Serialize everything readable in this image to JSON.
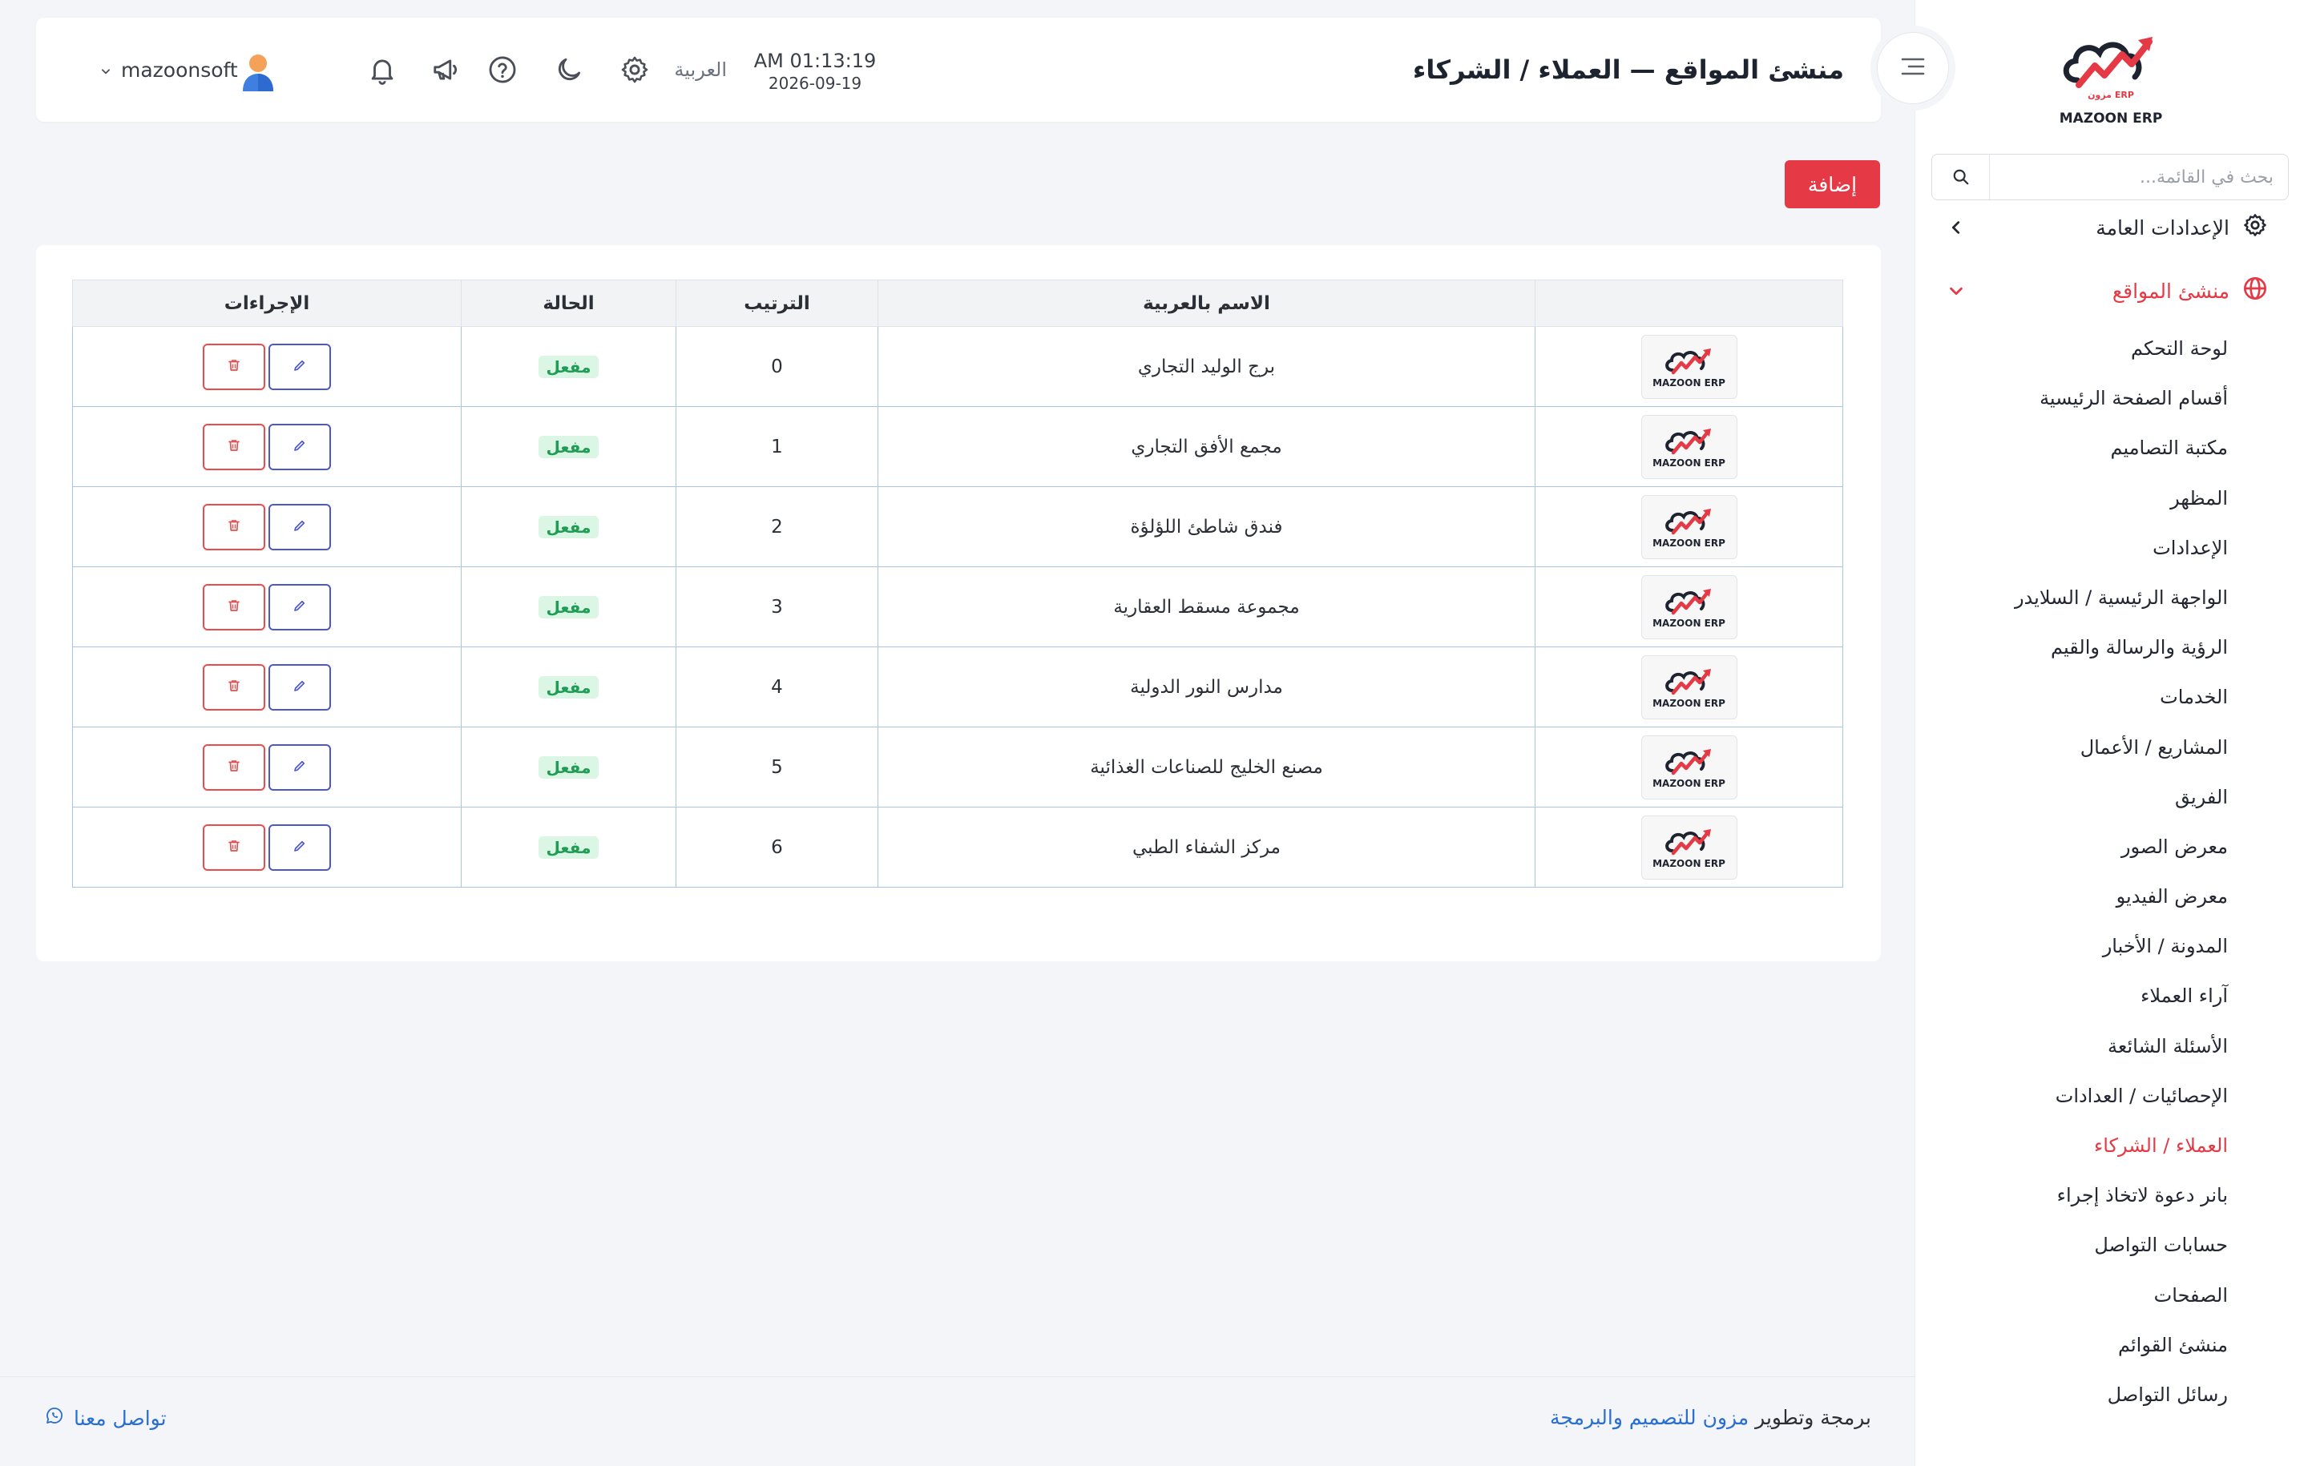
{
  "brand": {
    "name": "MAZOON ERP",
    "small": "مزون ERP"
  },
  "sidebar": {
    "search_placeholder": "بحث في القائمة...",
    "groups": [
      {
        "label": "الإعدادات العامة",
        "icon": "gear-icon",
        "state": "collapsed"
      },
      {
        "label": "منشئ المواقع",
        "icon": "globe-icon",
        "state": "expanded"
      }
    ],
    "items": [
      {
        "label": "لوحة التحكم"
      },
      {
        "label": "أقسام الصفحة الرئيسية"
      },
      {
        "label": "مكتبة التصاميم"
      },
      {
        "label": "المظهر"
      },
      {
        "label": "الإعدادات"
      },
      {
        "label": "الواجهة الرئيسية / السلايدر"
      },
      {
        "label": "الرؤية والرسالة والقيم"
      },
      {
        "label": "الخدمات"
      },
      {
        "label": "المشاريع / الأعمال"
      },
      {
        "label": "الفريق"
      },
      {
        "label": "معرض الصور"
      },
      {
        "label": "معرض الفيديو"
      },
      {
        "label": "المدونة / الأخبار"
      },
      {
        "label": "آراء العملاء"
      },
      {
        "label": "الأسئلة الشائعة"
      },
      {
        "label": "الإحصائيات / العدادات"
      },
      {
        "label": "العملاء / الشركاء",
        "active": true
      },
      {
        "label": "بانر دعوة لاتخاذ إجراء"
      },
      {
        "label": "حسابات التواصل"
      },
      {
        "label": "الصفحات"
      },
      {
        "label": "منشئ القوائم"
      },
      {
        "label": "رسائل التواصل"
      }
    ]
  },
  "header": {
    "title": "منشئ المواقع — العملاء / الشركاء",
    "time": "AM 01:13:19",
    "date": "2026-09-19",
    "language": "العربية",
    "username": "mazoonsoft"
  },
  "toolbar": {
    "add_label": "إضافة"
  },
  "table": {
    "columns": [
      "",
      "الاسم بالعربية",
      "الترتيب",
      "الحالة",
      "الإجراءات"
    ],
    "rows": [
      {
        "name": "برج الوليد التجاري",
        "order": "0",
        "status": "مفعل"
      },
      {
        "name": "مجمع الأفق التجاري",
        "order": "1",
        "status": "مفعل"
      },
      {
        "name": "فندق شاطئ اللؤلؤة",
        "order": "2",
        "status": "مفعل"
      },
      {
        "name": "مجموعة مسقط العقارية",
        "order": "3",
        "status": "مفعل"
      },
      {
        "name": "مدارس النور الدولية",
        "order": "4",
        "status": "مفعل"
      },
      {
        "name": "مصنع الخليج للصناعات الغذائية",
        "order": "5",
        "status": "مفعل"
      },
      {
        "name": "مركز الشفاء الطبي",
        "order": "6",
        "status": "مفعل"
      }
    ]
  },
  "footer": {
    "credit_prefix": "برمجة وتطوير",
    "credit_link": "مزون للتصميم والبرمجة",
    "contact": "تواصل معنا"
  },
  "colors": {
    "accent": "#e53945",
    "edit": "#4c57c9",
    "active_badge": "#1f9d55",
    "link": "#2a6fcf"
  }
}
